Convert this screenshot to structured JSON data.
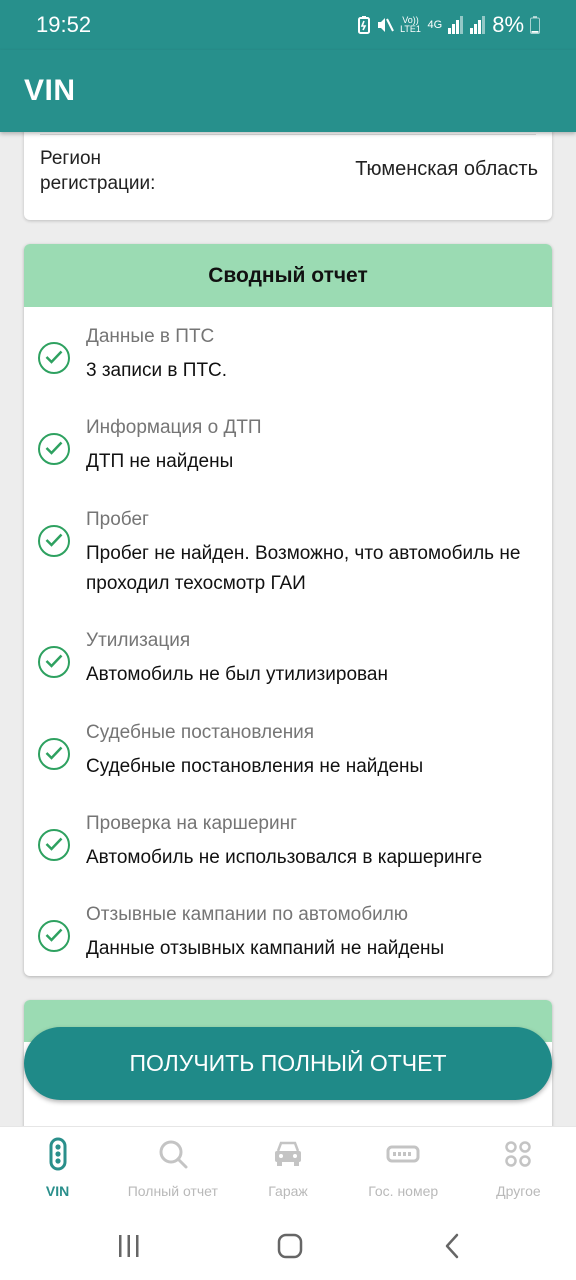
{
  "status": {
    "time": "19:52",
    "volte": "Vo)) LTE1",
    "network": "4G",
    "battery": "8%"
  },
  "app": {
    "title": "VIN"
  },
  "region": {
    "label": "Регион регистрации:",
    "value": "Тюменская область"
  },
  "summary": {
    "title": "Сводный отчет",
    "items": [
      {
        "title": "Данные в ПТС",
        "text": "3 записи в ПТС."
      },
      {
        "title": "Информация о ДТП",
        "text": "ДТП не найдены"
      },
      {
        "title": "Пробег",
        "text": "Пробег не найден. Возможно, что автомобиль не проходил техосмотр ГАИ"
      },
      {
        "title": "Утилизация",
        "text": "Автомобиль не был утилизирован"
      },
      {
        "title": "Судебные постановления",
        "text": "Судебные постановления не найдены"
      },
      {
        "title": "Проверка на каршеринг",
        "text": "Автомобиль не использовался в каршеринге"
      },
      {
        "title": "Отзывные кампании по автомобилю",
        "text": "Данные отзывных кампаний не найдены"
      }
    ]
  },
  "cta": {
    "label": "ПОЛУЧИТЬ ПОЛНЫЙ ОТЧЕТ"
  },
  "nav": {
    "items": [
      {
        "label": "VIN",
        "icon": "traffic-light-icon",
        "active": true
      },
      {
        "label": "Полный отчет",
        "icon": "search-icon",
        "active": false
      },
      {
        "label": "Гараж",
        "icon": "car-icon",
        "active": false
      },
      {
        "label": "Гос. номер",
        "icon": "license-plate-icon",
        "active": false
      },
      {
        "label": "Другое",
        "icon": "grid-icon",
        "active": false
      }
    ]
  },
  "colors": {
    "primary": "#27908c",
    "header_green": "#9bdbb3",
    "check_green": "#2ea160",
    "cta": "#1f8a88"
  }
}
